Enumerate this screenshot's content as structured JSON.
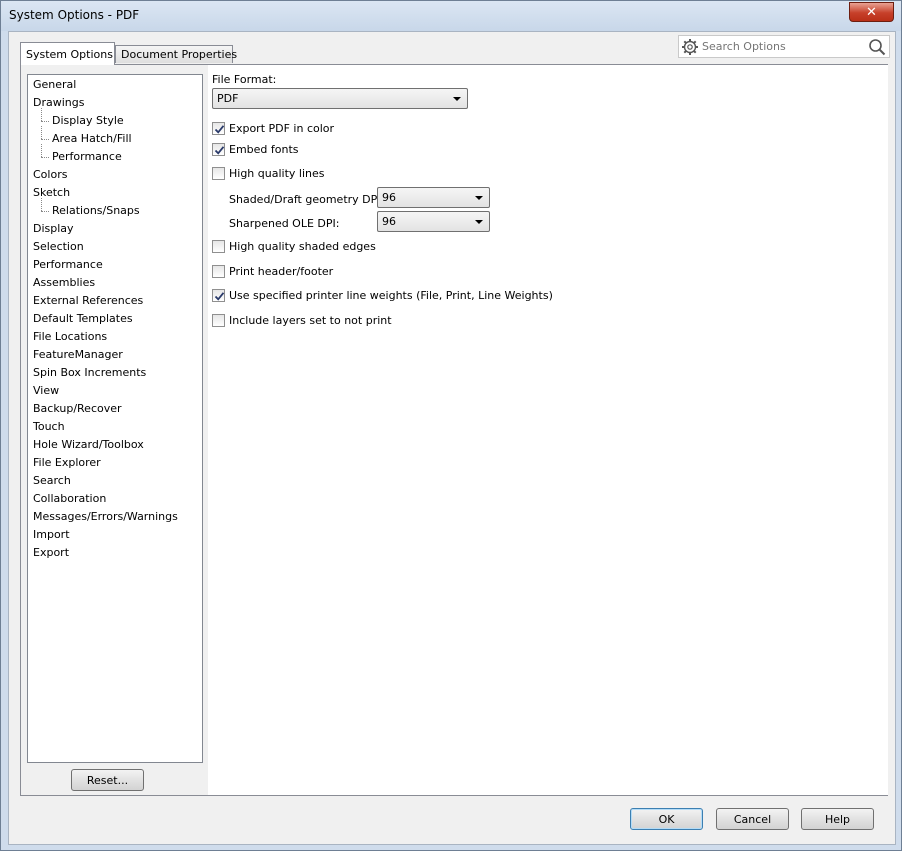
{
  "window": {
    "title": "System Options - PDF",
    "close_label": "✕"
  },
  "tabs": [
    {
      "label": "System Options",
      "active": true
    },
    {
      "label": "Document Properties",
      "active": false
    }
  ],
  "search": {
    "placeholder": "Search Options"
  },
  "tree": {
    "items": [
      {
        "label": "General",
        "level": 0
      },
      {
        "label": "Drawings",
        "level": 0
      },
      {
        "label": "Display Style",
        "level": 1
      },
      {
        "label": "Area Hatch/Fill",
        "level": 1
      },
      {
        "label": "Performance",
        "level": 1
      },
      {
        "label": "Colors",
        "level": 0
      },
      {
        "label": "Sketch",
        "level": 0
      },
      {
        "label": "Relations/Snaps",
        "level": 1
      },
      {
        "label": "Display",
        "level": 0
      },
      {
        "label": "Selection",
        "level": 0
      },
      {
        "label": "Performance",
        "level": 0
      },
      {
        "label": "Assemblies",
        "level": 0
      },
      {
        "label": "External References",
        "level": 0
      },
      {
        "label": "Default Templates",
        "level": 0
      },
      {
        "label": "File Locations",
        "level": 0
      },
      {
        "label": "FeatureManager",
        "level": 0
      },
      {
        "label": "Spin Box Increments",
        "level": 0
      },
      {
        "label": "View",
        "level": 0
      },
      {
        "label": "Backup/Recover",
        "level": 0
      },
      {
        "label": "Touch",
        "level": 0
      },
      {
        "label": "Hole Wizard/Toolbox",
        "level": 0
      },
      {
        "label": "File Explorer",
        "level": 0
      },
      {
        "label": "Search",
        "level": 0
      },
      {
        "label": "Collaboration",
        "level": 0
      },
      {
        "label": "Messages/Errors/Warnings",
        "level": 0
      },
      {
        "label": "Import",
        "level": 0
      },
      {
        "label": "Export",
        "level": 0
      }
    ],
    "reset_label": "Reset..."
  },
  "content": {
    "file_format_label": "File Format:",
    "file_format_value": "PDF",
    "export_color": {
      "label": "Export PDF in color",
      "checked": true
    },
    "embed_fonts": {
      "label": "Embed fonts",
      "checked": true
    },
    "high_quality_lines": {
      "label": "High quality lines",
      "checked": false
    },
    "shaded_dpi_label": "Shaded/Draft geometry DPI:",
    "shaded_dpi_value": "96",
    "ole_dpi_label": "Sharpened OLE DPI:",
    "ole_dpi_value": "96",
    "hq_shaded_edges": {
      "label": "High quality shaded edges",
      "checked": false
    },
    "print_header": {
      "label": "Print header/footer",
      "checked": false
    },
    "printer_weights": {
      "label": "Use specified printer line weights (File, Print, Line Weights)",
      "checked": true
    },
    "include_layers": {
      "label": "Include layers set to not print",
      "checked": false
    }
  },
  "buttons": {
    "ok": "OK",
    "cancel": "Cancel",
    "help": "Help"
  }
}
